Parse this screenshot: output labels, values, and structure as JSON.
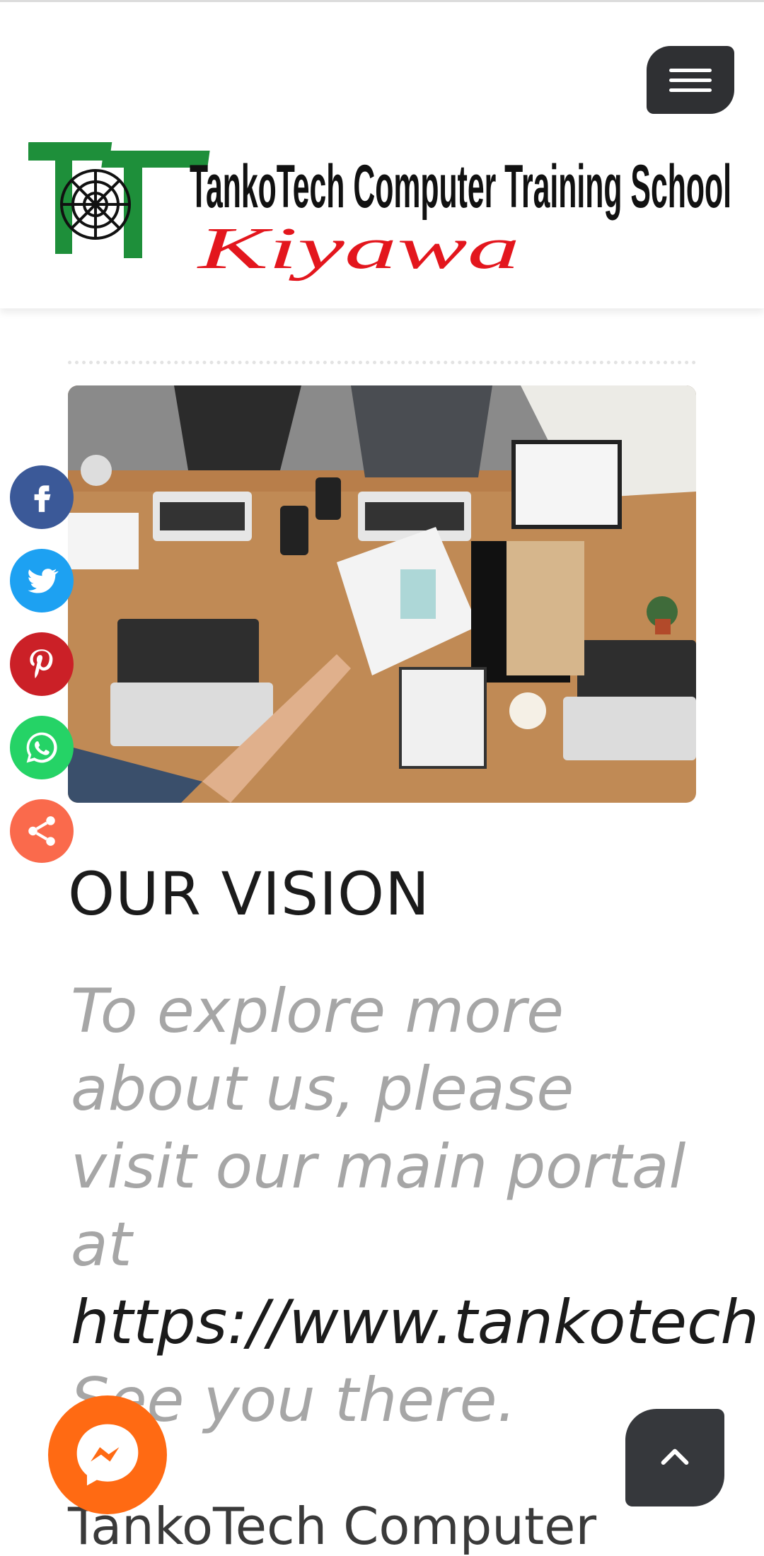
{
  "header": {
    "logo": {
      "title": "TankoTech Computer Training School",
      "subtitle": "Kiyawa"
    },
    "menu_button": {
      "icon": "hamburger-menu-icon"
    }
  },
  "social_share": [
    {
      "name": "facebook",
      "icon": "facebook-icon",
      "color": "#3b5998"
    },
    {
      "name": "twitter",
      "icon": "twitter-icon",
      "color": "#1da1f2"
    },
    {
      "name": "pinterest",
      "icon": "pinterest-icon",
      "color": "#cb2027"
    },
    {
      "name": "whatsapp",
      "icon": "whatsapp-icon",
      "color": "#25d366"
    },
    {
      "name": "share",
      "icon": "share-icon",
      "color": "#fa6a4c"
    }
  ],
  "main": {
    "hero_image": "office-team-laptops-photo",
    "vision": {
      "title": "OUR VISION",
      "text_lines": [
        "To explore more",
        "about us, please",
        "visit our main portal",
        "at"
      ],
      "link": "https://www.tankotech",
      "closing": "See you there."
    },
    "footer_brand": "TankoTech   Computer"
  },
  "floating": {
    "messenger": {
      "icon": "messenger-icon",
      "color": "#ff6a13"
    },
    "back_to_top": {
      "icon": "chevron-up-icon"
    }
  },
  "colors": {
    "accent_dark": "#2f3033",
    "muted_text": "#a6a6a6",
    "logo_green": "#1e8f3a",
    "logo_red": "#e3161d"
  }
}
